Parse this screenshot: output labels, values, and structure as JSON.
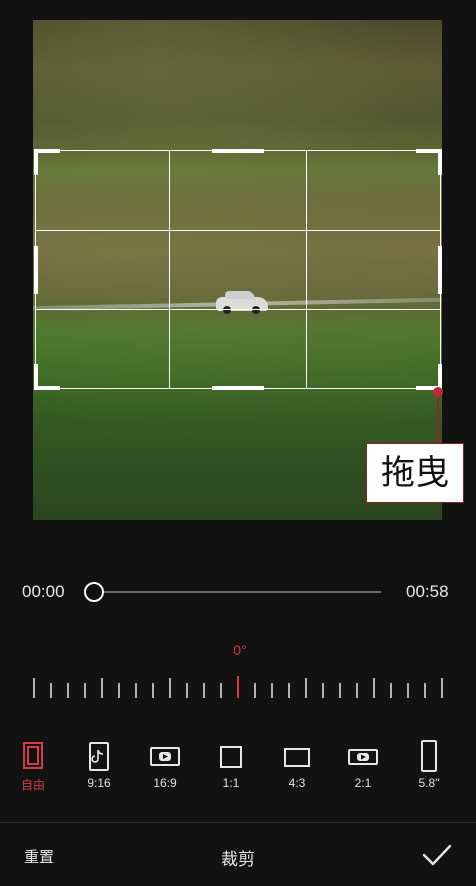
{
  "player": {
    "current_time": "00:00",
    "duration": "00:58",
    "progress": 0.0
  },
  "rotation": {
    "angle_label": "0°"
  },
  "callout": {
    "label": "拖曳"
  },
  "aspect_options": [
    {
      "label": "自由",
      "icon": "free-crop-icon",
      "active": true
    },
    {
      "label": "9:16",
      "icon": "tiktok-ratio-icon",
      "active": false
    },
    {
      "label": "16:9",
      "icon": "youtube-ratio-icon",
      "active": false
    },
    {
      "label": "1:1",
      "icon": "square-ratio-icon",
      "active": false
    },
    {
      "label": "4:3",
      "icon": "ratio-4-3-icon",
      "active": false
    },
    {
      "label": "2:1",
      "icon": "youtube-ratio-icon",
      "active": false
    },
    {
      "label": "5.8\"",
      "icon": "phone-ratio-icon",
      "active": false
    }
  ],
  "bottom_bar": {
    "reset_label": "重置",
    "title": "裁剪",
    "confirm_icon": "checkmark-icon"
  },
  "colors": {
    "accent": "#d33a4a",
    "background": "#121212"
  }
}
